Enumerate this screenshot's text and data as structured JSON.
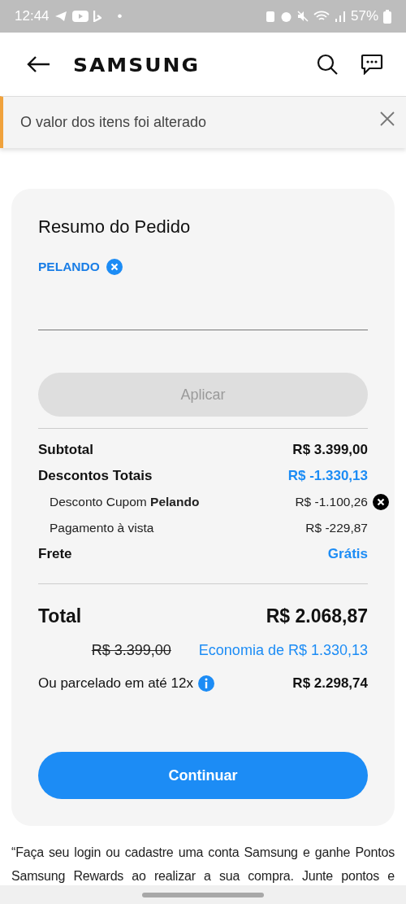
{
  "status_bar": {
    "time": "12:44",
    "dot": "•",
    "battery": "57%"
  },
  "header": {
    "logo": "SAMSUNG"
  },
  "notice": {
    "text": "O valor dos itens foi alterado",
    "dismissible": true
  },
  "order_summary": {
    "title": "Resumo do Pedido",
    "coupon": {
      "code": "PELANDO",
      "removable": true
    },
    "apply_button": {
      "label": "Aplicar",
      "disabled": true
    },
    "rows": [
      {
        "kind": "main",
        "label": "Subtotal",
        "value": "R$ 3.399,00",
        "accent": false,
        "removable": false
      },
      {
        "kind": "main",
        "label": "Descontos Totais",
        "value": "R$ -1.330,13",
        "accent": true,
        "removable": false
      },
      {
        "kind": "sub",
        "label": "Desconto Cupom **Pelando**",
        "value": "R$ -1.100,26",
        "accent": false,
        "removable": true
      },
      {
        "kind": "sub",
        "label": "Pagamento à vista",
        "value": "R$ -229,87",
        "accent": false,
        "removable": false
      },
      {
        "kind": "main",
        "label": "Frete",
        "value": "Grátis",
        "accent": true,
        "removable": false
      }
    ],
    "total": {
      "label": "Total",
      "value": "R$ 2.068,87"
    },
    "original_price": "R$ 3.399,00",
    "savings": "Economia de R$ 1.330,13",
    "installment": {
      "label": "Ou parcelado em até 12x",
      "value": "R$ 2.298,74"
    },
    "continue_button": {
      "label": "Continuar",
      "disabled": false
    }
  },
  "rewards_text": "“Faça seu login ou cadastre uma conta Samsung e ganhe Pontos Samsung Rewards ao realizar a sua compra. Junte pontos e"
}
